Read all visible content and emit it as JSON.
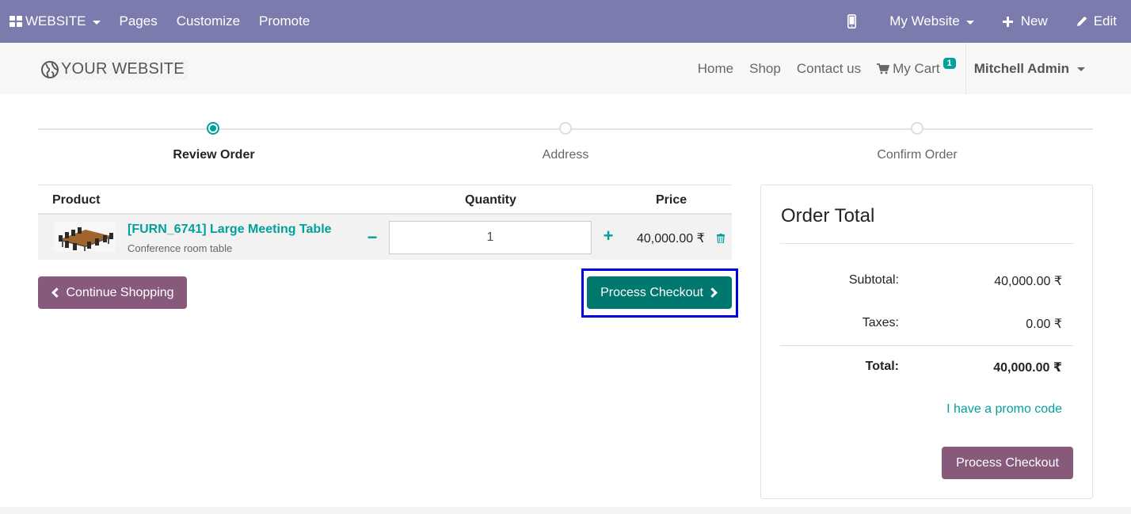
{
  "topbar": {
    "apps_label": "WEBSITE",
    "menu": [
      "Pages",
      "Customize",
      "Promote"
    ],
    "website_select": "My Website",
    "new_label": "New",
    "edit_label": "Edit"
  },
  "header": {
    "logo_text": "YOUR WEBSITE",
    "nav": [
      "Home",
      "Shop",
      "Contact us"
    ],
    "cart_label": "My Cart",
    "cart_count": "1",
    "user": "Mitchell Admin"
  },
  "steps": [
    {
      "label": "Review Order",
      "active": true
    },
    {
      "label": "Address",
      "active": false
    },
    {
      "label": "Confirm Order",
      "active": false
    }
  ],
  "cart": {
    "headers": {
      "product": "Product",
      "quantity": "Quantity",
      "price": "Price"
    },
    "line": {
      "name": "[FURN_6741] Large Meeting Table",
      "description": "Conference room table",
      "quantity": "1",
      "price": "40,000.00 ₹"
    },
    "minus": "−",
    "plus": "+",
    "continue_label": "Continue Shopping",
    "checkout_label": "Process Checkout"
  },
  "summary": {
    "title": "Order Total",
    "subtotal_label": "Subtotal:",
    "subtotal": "40,000.00 ₹",
    "taxes_label": "Taxes:",
    "taxes": "0.00 ₹",
    "total_label": "Total:",
    "total": "40,000.00 ₹",
    "promo_label": "I have a promo code",
    "checkout_label": "Process Checkout"
  },
  "colors": {
    "admin_bar": "#7c7bad",
    "primary": "#00a09d",
    "secondary": "#875a7b",
    "highlight": "#0000dd"
  }
}
